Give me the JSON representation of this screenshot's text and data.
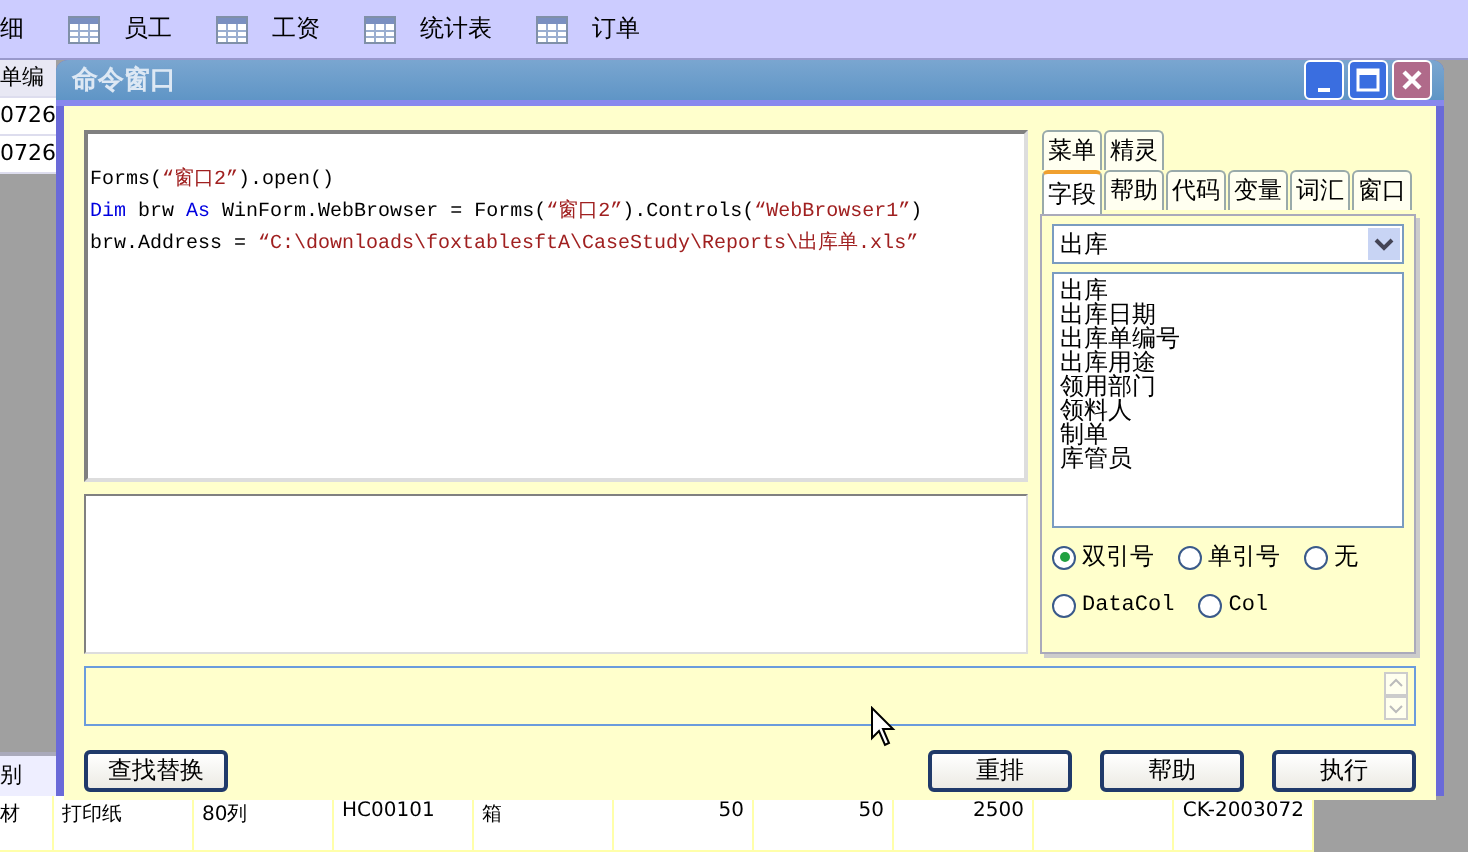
{
  "toolbar": {
    "cut_item": "细",
    "items": [
      "员工",
      "工资",
      "统计表",
      "订单"
    ]
  },
  "left_table": {
    "header": "单编",
    "rows": [
      "0726",
      "0726"
    ],
    "footer_header": "别"
  },
  "bottom_table": {
    "cells": [
      {
        "text": "材",
        "kind": "text"
      },
      {
        "text": "打印纸",
        "kind": "text"
      },
      {
        "text": "80列",
        "kind": "text"
      },
      {
        "text": "HC00101",
        "kind": "text"
      },
      {
        "text": "箱",
        "kind": "text"
      },
      {
        "text": "50",
        "kind": "number"
      },
      {
        "text": "50",
        "kind": "number"
      },
      {
        "text": "2500",
        "kind": "number"
      },
      {
        "text": "",
        "kind": "text"
      },
      {
        "text": "CK-2003072",
        "kind": "number"
      }
    ]
  },
  "window": {
    "title": "命令窗口"
  },
  "code_lines": [
    [
      {
        "kind": "plain",
        "text": "Forms("
      },
      {
        "kind": "string",
        "text": "“窗口2”"
      },
      {
        "kind": "plain",
        "text": ").open()"
      }
    ],
    [
      {
        "kind": "keyword",
        "text": "Dim"
      },
      {
        "kind": "plain",
        "text": " brw "
      },
      {
        "kind": "keyword",
        "text": "As"
      },
      {
        "kind": "plain",
        "text": " WinForm.WebBrowser = Forms("
      },
      {
        "kind": "string",
        "text": "“窗口2”"
      },
      {
        "kind": "plain",
        "text": ").Controls("
      },
      {
        "kind": "string",
        "text": "“WebBrowser1”"
      },
      {
        "kind": "plain",
        "text": ")"
      }
    ],
    [
      {
        "kind": "plain",
        "text": "brw.Address = "
      },
      {
        "kind": "string",
        "text": "“C:\\downloads\\foxtablesftA\\CaseStudy\\Reports\\出库单.xls”"
      }
    ]
  ],
  "tabs_top": [
    {
      "label": "菜单",
      "selected": false
    },
    {
      "label": "精灵",
      "selected": false
    }
  ],
  "tabs": [
    {
      "label": "字段",
      "selected": true
    },
    {
      "label": "帮助",
      "selected": false
    },
    {
      "label": "代码",
      "selected": false
    },
    {
      "label": "变量",
      "selected": false
    },
    {
      "label": "词汇",
      "selected": false
    },
    {
      "label": "窗口",
      "selected": false
    }
  ],
  "table_select": {
    "value": "出库"
  },
  "fields": [
    "出库",
    "出库日期",
    "出库单编号",
    "出库用途",
    "领用部门",
    "领料人",
    "制单",
    "库管员"
  ],
  "quote_options": [
    {
      "label": "双引号",
      "selected": true
    },
    {
      "label": "单引号",
      "selected": false
    },
    {
      "label": "无",
      "selected": false
    },
    {
      "label": "DataCol",
      "selected": false
    },
    {
      "label": "Col",
      "selected": false
    }
  ],
  "buttons_left": [
    "查找替换"
  ],
  "buttons_right": [
    "重排",
    "帮助",
    "执行"
  ]
}
